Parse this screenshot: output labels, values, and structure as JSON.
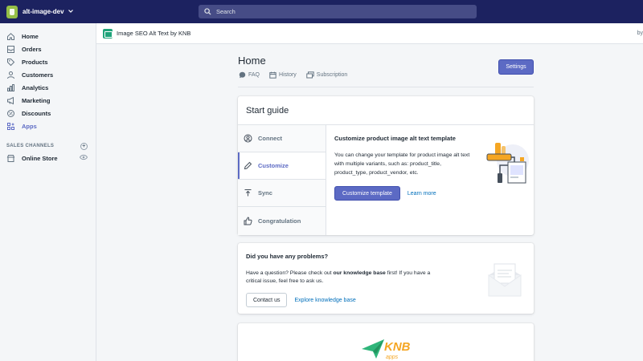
{
  "topbar": {
    "store_name": "alt-image-dev",
    "search_placeholder": "Search"
  },
  "sidebar": {
    "items": [
      {
        "label": "Home",
        "icon": "home-icon"
      },
      {
        "label": "Orders",
        "icon": "orders-icon"
      },
      {
        "label": "Products",
        "icon": "tag-icon"
      },
      {
        "label": "Customers",
        "icon": "person-icon"
      },
      {
        "label": "Analytics",
        "icon": "bar-chart-icon"
      },
      {
        "label": "Marketing",
        "icon": "megaphone-icon"
      },
      {
        "label": "Discounts",
        "icon": "discount-icon"
      },
      {
        "label": "Apps",
        "icon": "apps-icon",
        "active": true
      }
    ],
    "sales_channels_heading": "SALES CHANNELS",
    "online_store_label": "Online Store"
  },
  "appbar": {
    "title": "Image SEO Alt Text by KNB",
    "by_text": "by"
  },
  "page": {
    "title": "Home",
    "actions": [
      {
        "label": "FAQ",
        "icon": "chat-icon"
      },
      {
        "label": "History",
        "icon": "calendar-icon"
      },
      {
        "label": "Subscription",
        "icon": "cards-icon"
      }
    ],
    "settings_label": "Settings"
  },
  "start_guide": {
    "title": "Start guide",
    "steps": [
      {
        "label": "Connect",
        "icon": "user-circle-icon"
      },
      {
        "label": "Customize",
        "icon": "pencil-icon",
        "active": true
      },
      {
        "label": "Sync",
        "icon": "upload-icon"
      },
      {
        "label": "Congratulation",
        "icon": "thumbs-up-icon"
      }
    ],
    "heading": "Customize product image alt text template",
    "text": "You can change your template for product image alt text with multiple variants, such as: product_title, product_type, product_vendor, etc.",
    "primary_label": "Customize template",
    "link_label": "Learn more"
  },
  "problems": {
    "title": "Did you have any problems?",
    "text_before": "Have a question? Please check out ",
    "text_bold": "our knowledge base",
    "text_after": " first! If you have a critical issue, feel free to ask us.",
    "contact_label": "Contact us",
    "explore_label": "Explore knowledge base"
  },
  "logo": {
    "text": "KNB",
    "subtext": "apps"
  },
  "colors": {
    "topbar": "#1c2260",
    "accent": "#5c6ac4",
    "link": "#006fbb",
    "logo_green": "#2fb57a",
    "logo_orange": "#f5a623"
  }
}
